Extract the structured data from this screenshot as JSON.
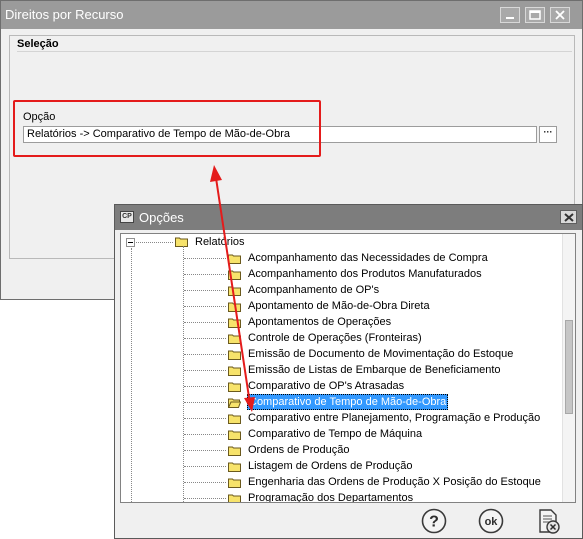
{
  "main_window": {
    "title": "Direitos por Recurso",
    "buttons": [
      {
        "name": "minimize",
        "icon": "minimize-icon"
      },
      {
        "name": "maximize",
        "icon": "maximize-icon"
      },
      {
        "name": "close",
        "icon": "close-icon"
      }
    ],
    "group_title": "Seleção",
    "field_label": "Opção",
    "field_value": "Relatórios -> Comparativo de Tempo de Mão-de-Obra",
    "browse_label": "···"
  },
  "dialog": {
    "app_icon_label": "CP",
    "title": "Opções",
    "tree": {
      "root_label": "Relatórios",
      "items": [
        "Acompanhamento das Necessidades de Compra",
        "Acompanhamento dos Produtos Manufaturados",
        "Acompanhamento de OP's",
        "Apontamento de Mão-de-Obra Direta",
        "Apontamentos de Operações",
        "Controle de Operações (Fronteiras)",
        "Emissão de Documento de Movimentação do Estoque",
        "Emissão de Listas de Embarque de Beneficiamento",
        "Comparativo de OP's Atrasadas",
        "Comparativo de Tempo de Mão-de-Obra",
        "Comparativo entre Planejamento, Programação e Produção",
        "Comparativo de Tempo de Máquina",
        "Ordens de Produção",
        "Listagem de Ordens de Produção",
        "Engenharia das Ordens de Produção X Posição do Estoque",
        "Programação dos Departamentos"
      ],
      "selected_index": 9
    },
    "footer_buttons": [
      {
        "name": "help",
        "icon": "help-icon",
        "label": "?"
      },
      {
        "name": "ok",
        "icon": "ok-icon",
        "label": "ok"
      },
      {
        "name": "cancel",
        "icon": "cancel-icon"
      }
    ]
  },
  "annotation": {
    "highlight_color": "#e41b1b"
  }
}
